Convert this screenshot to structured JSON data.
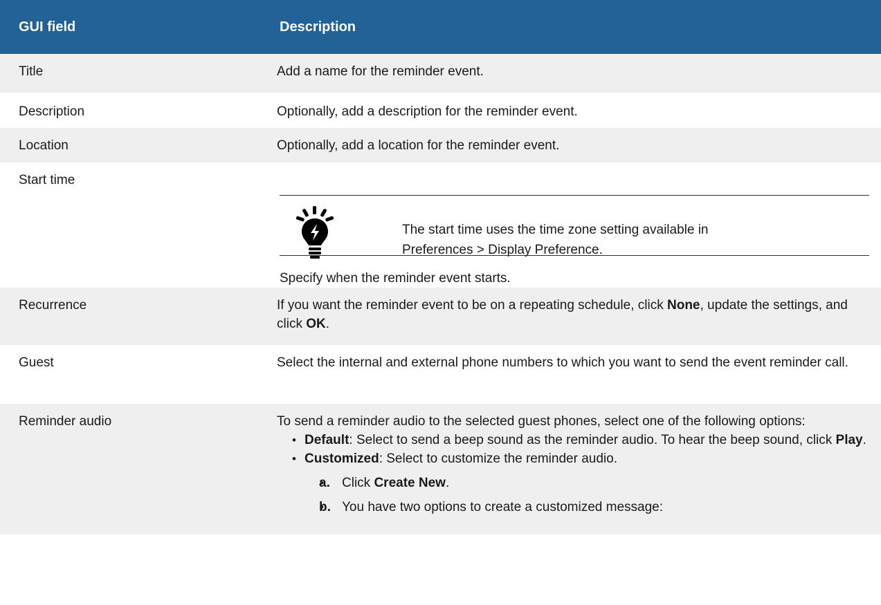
{
  "header": {
    "col1": "GUI field",
    "col2": "Description"
  },
  "rows": {
    "title": {
      "field": "Title",
      "desc": "Add a name for the reminder event."
    },
    "description": {
      "field": "Description",
      "desc": "Optionally, add a description for the reminder event."
    },
    "location": {
      "field": "Location",
      "desc": "Optionally, add a location for the reminder event."
    },
    "start_time": {
      "field": "Start time",
      "tip_line1": "The start time uses the time zone setting available in",
      "tip_line2": "Preferences > Display Preference.",
      "desc": "Specify when the reminder event starts."
    },
    "recurrence": {
      "field": "Recurrence",
      "t1": "If you want the reminder event to be on a repeating schedule, click ",
      "b1": "None",
      "t2": ", update the settings, and click ",
      "b2": "OK",
      "t3": "."
    },
    "guest": {
      "field": "Guest",
      "desc": "Select the internal and external phone numbers to which you want to send the event reminder call."
    },
    "reminder_audio": {
      "field": "Reminder audio",
      "intro": "To send a reminder audio to the selected guest phones, select one of the following options:",
      "opt1_b": "Default",
      "opt1_t1": ": Select to send a beep sound as the reminder audio. To hear the beep sound, click ",
      "opt1_b2": "Play",
      "opt1_t2": ".",
      "opt2_b": "Customized",
      "opt2_t": ": Select to customize the reminder audio.",
      "step_a_mk": "a.",
      "step_a_t": "Click ",
      "step_a_b": "Create New",
      "step_a_t2": ".",
      "step_b_mk": "b.",
      "step_b_t": "You have two options to create a customized message:"
    }
  },
  "colors": {
    "header_bg": "#226296",
    "alt_row_bg": "#efefef"
  },
  "icons": {
    "tip": "lightbulb-icon"
  }
}
